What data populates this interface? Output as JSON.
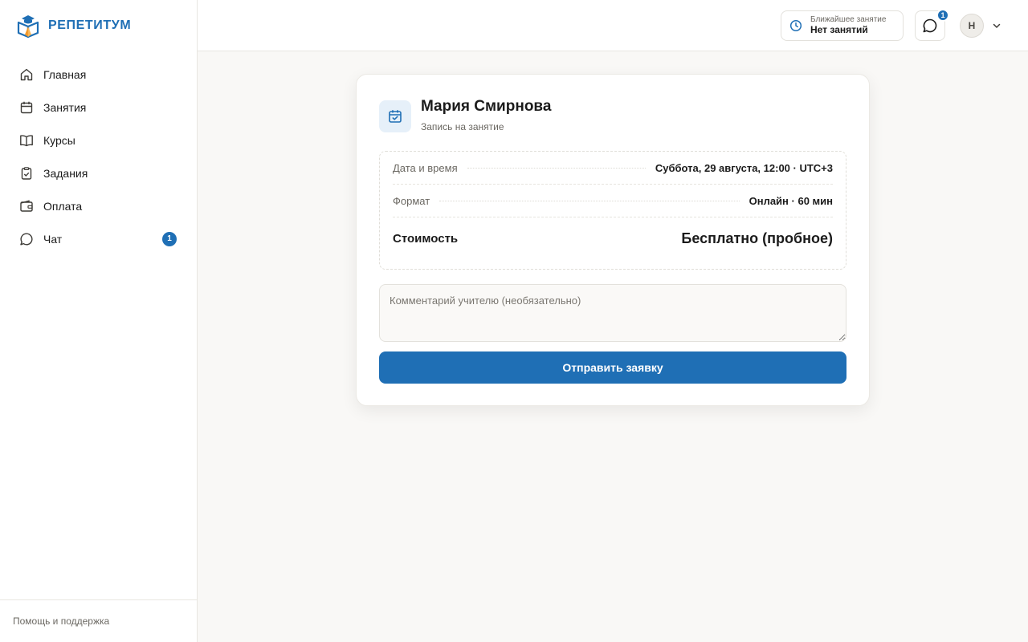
{
  "brand": {
    "name": "РЕПЕТИТУМ"
  },
  "sidebar": {
    "items": [
      {
        "label": "Главная",
        "icon": "home-icon"
      },
      {
        "label": "Занятия",
        "icon": "calendar-icon"
      },
      {
        "label": "Курсы",
        "icon": "book-icon"
      },
      {
        "label": "Задания",
        "icon": "clipboard-check-icon"
      },
      {
        "label": "Оплата",
        "icon": "wallet-icon"
      },
      {
        "label": "Чат",
        "icon": "chat-icon",
        "badge": "1"
      }
    ],
    "footer_link": "Помощь и поддержка"
  },
  "topbar": {
    "next_lesson_caption": "Ближайшее занятие",
    "next_lesson_value": "Нет занятий",
    "chat_badge": "1",
    "avatar_initial": "Н"
  },
  "card": {
    "title": "Мария Смирнова",
    "subtitle": "Запись на занятие",
    "rows": [
      {
        "label": "Дата и время",
        "value": "Суббота, 29 августа, 12:00 · UTC+3"
      },
      {
        "label": "Формат",
        "value": "Онлайн · 60 мин"
      },
      {
        "label": "Стоимость",
        "value": "Бесплатно (пробное)"
      }
    ],
    "comment_placeholder": "Комментарий учителю (необязательно)",
    "submit_label": "Отправить заявку"
  },
  "colors": {
    "accent": "#1f6fb5",
    "accent_light": "#e6f0f9",
    "background": "#f9f8f6",
    "logo_orange": "#f39a2b"
  }
}
